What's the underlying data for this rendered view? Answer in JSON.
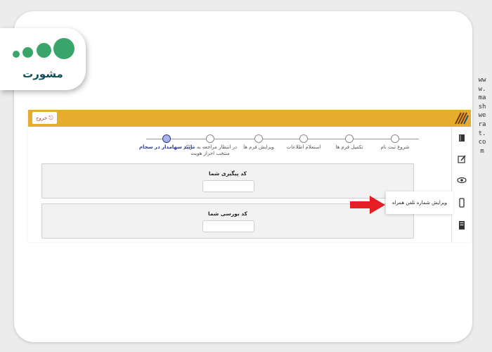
{
  "logo": {
    "text": "مشورت",
    "dot_color": "#3aa56a",
    "text_color": "#0f4f5c"
  },
  "watermark": "www.mashwerat.com",
  "topbar": {
    "color": "#e6ac2e",
    "exit_label": "خروج",
    "exit_icon": "logout-icon",
    "brand_icon": "brand-stripes-icon"
  },
  "stepper": {
    "steps": [
      {
        "label": "شروع ثبت نام",
        "active": false
      },
      {
        "label": "تکمیل فرم ها",
        "active": false
      },
      {
        "label": "استعلام اطلاعات",
        "active": false
      },
      {
        "label": "ویرایش فرم ها",
        "active": false
      },
      {
        "label": "در انتظار مراجعه به مراکز منتخب احراز هویت",
        "active": false
      },
      {
        "label": "تایید سهامدار در سجام",
        "active": true
      }
    ],
    "active_color": "#2b3a9a"
  },
  "panels": {
    "tracking_label": "کد پیگیری شما",
    "tracking_value": "",
    "bourse_label": "کد بورسی شما",
    "bourse_value": ""
  },
  "sidebar": {
    "items": [
      {
        "icon": "book-icon"
      },
      {
        "icon": "edit-icon"
      },
      {
        "icon": "eye-icon"
      },
      {
        "icon": "mobile-phone-icon"
      },
      {
        "icon": "document-icon"
      }
    ]
  },
  "tooltip": {
    "text": "ویرایش شماره تلفن همراه"
  },
  "annotation": {
    "arrow_color": "#e31e24"
  }
}
